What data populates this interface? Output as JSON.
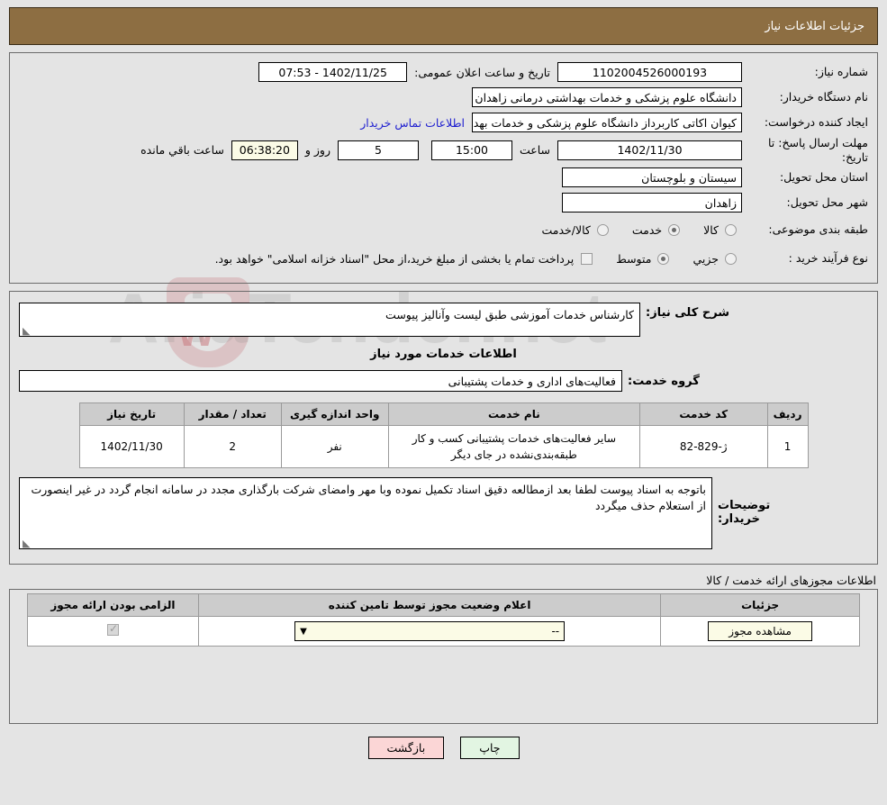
{
  "header": {
    "title": "جزئیات اطلاعات نیاز"
  },
  "watermark": {
    "text": "AriaTender.net"
  },
  "form": {
    "need_number_label": "شماره نیاز:",
    "need_number_value": "1102004526000193",
    "public_announce_label": "تاریخ و ساعت اعلان عمومی:",
    "public_announce_value": "1402/11/25 - 07:53",
    "buyer_org_label": "نام دستگاه خریدار:",
    "buyer_org_value": "دانشگاه علوم پزشکی و خدمات بهداشتی درمانی زاهدان",
    "creator_label": "ایجاد کننده درخواست:",
    "creator_value": "کیوان اکاتی کاربرداز دانشگاه علوم پزشکی و خدمات بهداشتی درمانی زاهدان",
    "contact_link": "اطلاعات تماس خریدار",
    "deadline_label": "مهلت ارسال پاسخ: تا تاریخ:",
    "deadline_date": "1402/11/30",
    "time_label": "ساعت",
    "time_value": "15:00",
    "days_value": "5",
    "days_label": "روز و",
    "countdown_value": "06:38:20",
    "countdown_label": "ساعت باقي مانده",
    "province_label": "استان محل تحویل:",
    "province_value": "سیستان و بلوچستان",
    "city_label": "شهر محل تحویل:",
    "city_value": "زاهدان",
    "category_label": "طبقه بندی موضوعی:",
    "category_options": [
      {
        "label": "کالا",
        "selected": false
      },
      {
        "label": "خدمت",
        "selected": true
      },
      {
        "label": "کالا/خدمت",
        "selected": false
      }
    ],
    "process_label": "نوع فرآیند خرید :",
    "process_options": [
      {
        "label": "جزیي",
        "selected": false
      },
      {
        "label": "متوسط",
        "selected": true
      }
    ],
    "treasury_checkbox_checked": false,
    "treasury_note": "پرداخت تمام یا بخشی از مبلغ خرید،از محل \"اسناد خزانه اسلامی\" خواهد بود."
  },
  "description": {
    "general_label": "شرح کلی نیاز:",
    "general_value": "کارشناس خدمات آموزشی طبق لیست وآنالیز پیوست",
    "services_info_title": "اطلاعات خدمات مورد نیاز",
    "service_group_label": "گروه خدمت:",
    "service_group_value": "فعالیت‌های اداری و خدمات پشتیبانی"
  },
  "services_table": {
    "headers": [
      "ردیف",
      "کد خدمت",
      "نام خدمت",
      "واحد اندازه گیری",
      "تعداد / مقدار",
      "تاریخ نیاز"
    ],
    "rows": [
      {
        "row": "1",
        "code": "ژ-829-82",
        "name": "سایر فعالیت‌های خدمات پشتیبانی کسب و کار طبقه‌بندی‌نشده در جای دیگر",
        "unit": "نفر",
        "quantity": "2",
        "need_date": "1402/11/30"
      }
    ]
  },
  "buyer_notes": {
    "label": "توضیحات خریدار:",
    "value": "باتوجه به اسناد پیوست لطفا بعد ازمطالعه دقیق اسناد تکمیل نموده وبا مهر وامضای شرکت بارگذاری مجدد در سامانه انجام گردد در غیر اینصورت از استعلام حذف میگردد"
  },
  "permits": {
    "caption": "اطلاعات مجوزهای ارائه خدمت / کالا",
    "headers": [
      "الزامی بودن ارائه مجوز",
      "اعلام وضعیت مجوز توسط تامین کننده",
      "جزئیات"
    ],
    "rows": [
      {
        "required_checked": true,
        "status_value": "--",
        "details_button": "مشاهده مجوز"
      }
    ]
  },
  "footer": {
    "back_button": "بازگشت",
    "print_button": "چاپ"
  },
  "colors": {
    "header_bg": "#8d6e42",
    "link": "#2020d0",
    "back_button_bg": "#fbd6d6",
    "print_button_bg": "#e2f5e2",
    "cream_field": "#fbfbe6",
    "table_header_bg": "#cccccc"
  }
}
